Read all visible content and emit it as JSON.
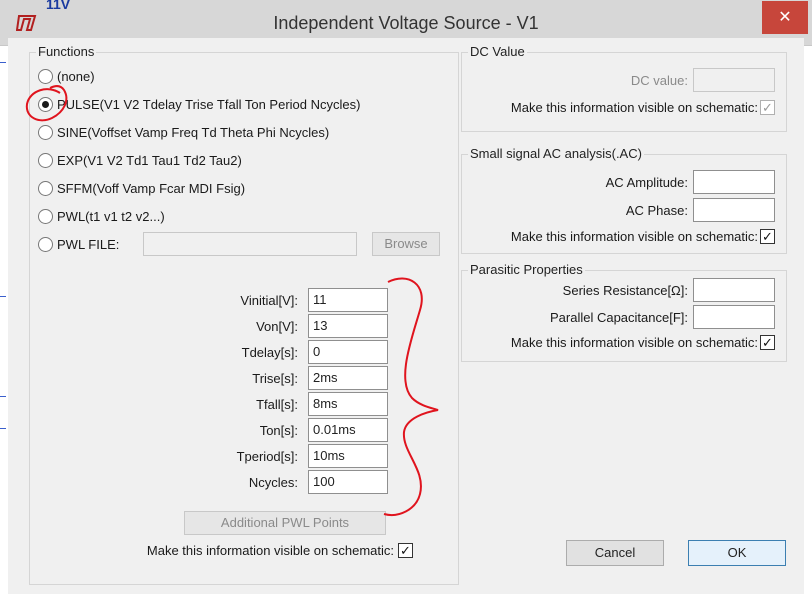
{
  "window": {
    "title": "Independent Voltage Source - V1",
    "close_glyph": "✕",
    "stray_text": "11V"
  },
  "functions": {
    "group_label": "Functions",
    "options": [
      {
        "label": "(none)",
        "selected": false
      },
      {
        "label": "PULSE(V1 V2 Tdelay Trise Tfall Ton Period Ncycles)",
        "selected": true
      },
      {
        "label": "SINE(Voffset Vamp Freq Td Theta Phi Ncycles)",
        "selected": false
      },
      {
        "label": "EXP(V1 V2 Td1 Tau1 Td2 Tau2)",
        "selected": false
      },
      {
        "label": "SFFM(Voff Vamp Fcar MDI Fsig)",
        "selected": false
      },
      {
        "label": "PWL(t1 v1 t2 v2...)",
        "selected": false
      },
      {
        "label": "PWL FILE:",
        "selected": false
      }
    ],
    "pwl_file_value": "",
    "browse_label": "Browse",
    "params": [
      {
        "label": "Vinitial[V]:",
        "value": "11"
      },
      {
        "label": "Von[V]:",
        "value": "13"
      },
      {
        "label": "Tdelay[s]:",
        "value": "0"
      },
      {
        "label": "Trise[s]:",
        "value": "2ms"
      },
      {
        "label": "Tfall[s]:",
        "value": "8ms"
      },
      {
        "label": "Ton[s]:",
        "value": "0.01ms"
      },
      {
        "label": "Tperiod[s]:",
        "value": "10ms"
      },
      {
        "label": "Ncycles:",
        "value": "100"
      }
    ],
    "additional_pwl_label": "Additional PWL Points",
    "visible_label": "Make this information visible on schematic:",
    "visible_checked": true
  },
  "dc_value": {
    "group_label": "DC Value",
    "field_label": "DC value:",
    "field_value": "",
    "visible_label": "Make this information visible on schematic:",
    "visible_checked": true
  },
  "ac_analysis": {
    "group_label": "Small signal AC analysis(.AC)",
    "amplitude_label": "AC Amplitude:",
    "amplitude_value": "",
    "phase_label": "AC Phase:",
    "phase_value": "",
    "visible_label": "Make this information visible on schematic:",
    "visible_checked": true
  },
  "parasitic": {
    "group_label": "Parasitic Properties",
    "series_label": "Series Resistance[Ω]:",
    "series_value": "",
    "parallel_label": "Parallel Capacitance[F]:",
    "parallel_value": "",
    "visible_label": "Make this information visible on schematic:",
    "visible_checked": true
  },
  "buttons": {
    "cancel": "Cancel",
    "ok": "OK"
  },
  "check_glyph": "✓",
  "colors": {
    "annotation": "#e0141e",
    "close_button": "#c7463b"
  }
}
